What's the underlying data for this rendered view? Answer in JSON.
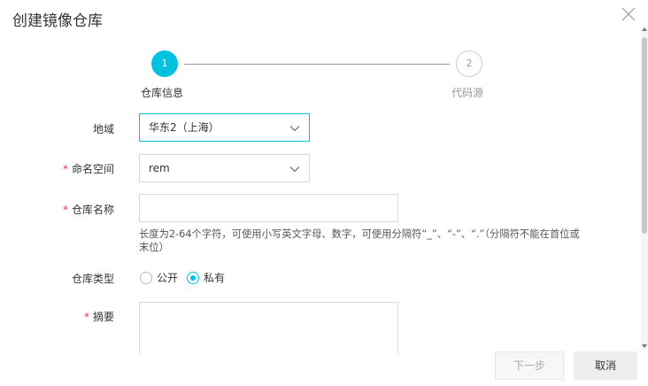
{
  "dialog": {
    "title": "创建镜像仓库"
  },
  "steps": [
    {
      "number": "1",
      "label": "仓库信息",
      "active": true
    },
    {
      "number": "2",
      "label": "代码源",
      "active": false
    }
  ],
  "form": {
    "region": {
      "label": "地域",
      "value": "华东2（上海）"
    },
    "namespace": {
      "required_mark": "*",
      "label": "命名空间",
      "value": "rem"
    },
    "repo_name": {
      "required_mark": "*",
      "label": "仓库名称",
      "value": "",
      "placeholder": ""
    },
    "hint": "长度为2-64个字符，可使用小写英文字母、数字，可使用分隔符“_”、“-”、“.”（分隔符不能在首位或末位）",
    "repo_type": {
      "label": "仓库类型",
      "options": [
        {
          "label": "公开",
          "checked": false
        },
        {
          "label": "私有",
          "checked": true
        }
      ]
    },
    "summary": {
      "required_mark": "*",
      "label": "摘要",
      "value": ""
    }
  },
  "footer": {
    "next_label": "下一步",
    "cancel_label": "取消"
  },
  "colors": {
    "accent": "#00c1de",
    "required": "#e4393c"
  },
  "icons": {
    "close": "close-icon",
    "dropdown": "chevron-down-icon"
  }
}
